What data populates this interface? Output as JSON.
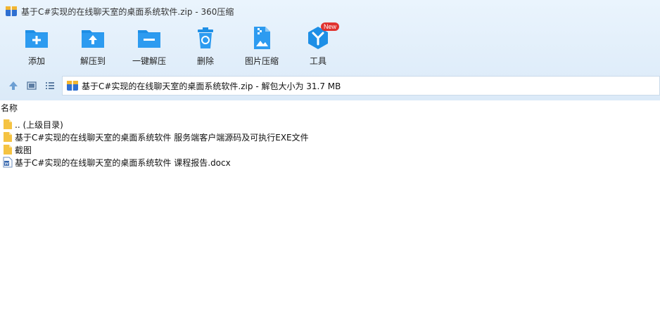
{
  "window": {
    "title": "基于C#实现的在线聊天室的桌面系统软件.zip - 360压缩"
  },
  "toolbar": {
    "add_label": "添加",
    "extract_to_label": "解压到",
    "one_click_extract_label": "一键解压",
    "delete_label": "删除",
    "image_compress_label": "图片压缩",
    "tools_label": "工具",
    "tools_badge": "New"
  },
  "navbar": {
    "address": "基于C#实现的在线聊天室的桌面系统软件.zip - 解包大小为 31.7 MB"
  },
  "list": {
    "header_name": "名称",
    "items": [
      {
        "name": ".. (上级目录)",
        "icon": "folder-icon"
      },
      {
        "name": "基于C#实现的在线聊天室的桌面系统软件 服务端客户端源码及可执行EXE文件",
        "icon": "folder-icon"
      },
      {
        "name": "截图",
        "icon": "folder-icon"
      },
      {
        "name": "基于C#实现的在线聊天室的桌面系统软件 课程报告.docx",
        "icon": "word-doc-icon"
      }
    ]
  },
  "colors": {
    "accent": "#1e8fe6",
    "toolbar_bg": "#e3effb",
    "badge": "#e0332f",
    "folder": "#f5c342"
  }
}
